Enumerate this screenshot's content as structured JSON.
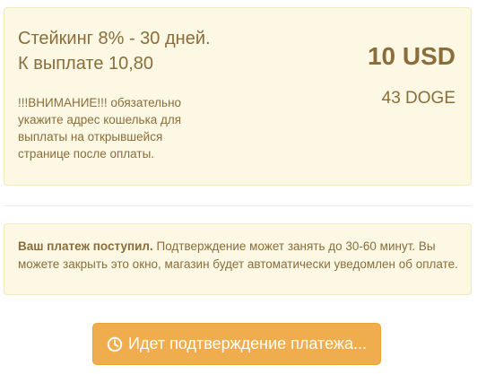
{
  "order": {
    "title_line1": "Стейкинг 8% - 30 дней.",
    "title_line2": "К выплате 10,80",
    "warning": "!!!ВНИМАНИЕ!!! обязательно укажите адрес кошелька для выплаты на открывшейся странице после оплаты.",
    "price_usd": "10 USD",
    "price_doge": "43 DOGE"
  },
  "notice": {
    "bold": "Ваш платеж поступил.",
    "text": " Подтверждение может занять до 30-60 минут. Вы можете закрыть это окно, магазин будет автоматически уведомлен об оплате."
  },
  "button": {
    "icon": "clock-icon",
    "label": "Идет подтверждение платежа..."
  },
  "colors": {
    "panel_bg": "#fcf8e3",
    "text": "#8a6d3b",
    "button_bg": "#f0ad4e"
  }
}
